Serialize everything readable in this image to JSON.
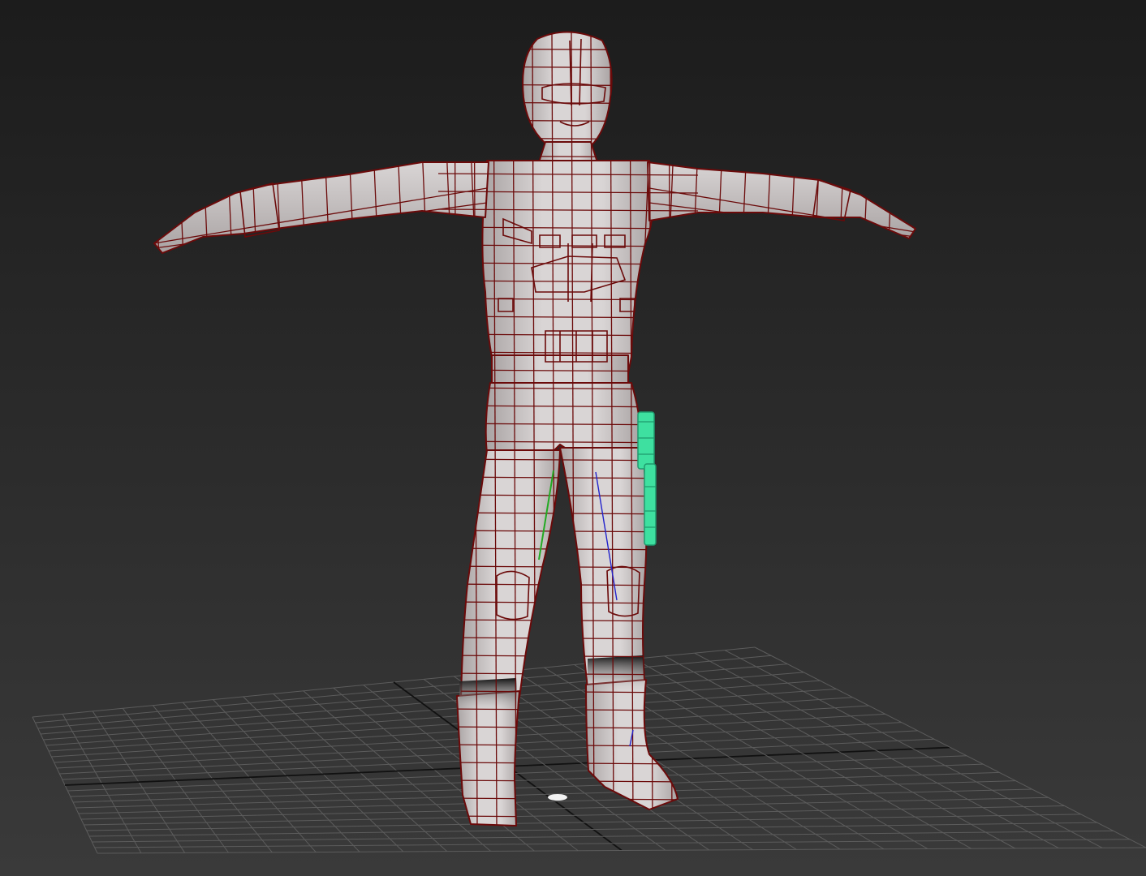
{
  "viewport": {
    "kind": "3d-perspective-viewport",
    "shading": "shaded-with-edged-faces",
    "colors": {
      "background_top": "#1c1c1c",
      "background_bottom": "#3a3a3a",
      "grid_line": "#5c5c5c",
      "grid_axis": "#111111",
      "mesh_fill": "#d9d5d5",
      "mesh_shadow": "#a9a3a3",
      "wire_edge": "#6b0a0a",
      "selected_object": "#3ee0a0",
      "bone_blue": "#2222cc",
      "bone_green": "#22aa22",
      "pivot_marker": "#f2f2f2"
    },
    "objects": [
      {
        "name": "character-body-mesh",
        "pose": "T-pose",
        "selected": false
      },
      {
        "name": "leg-holster-prop",
        "selected": true
      }
    ]
  }
}
